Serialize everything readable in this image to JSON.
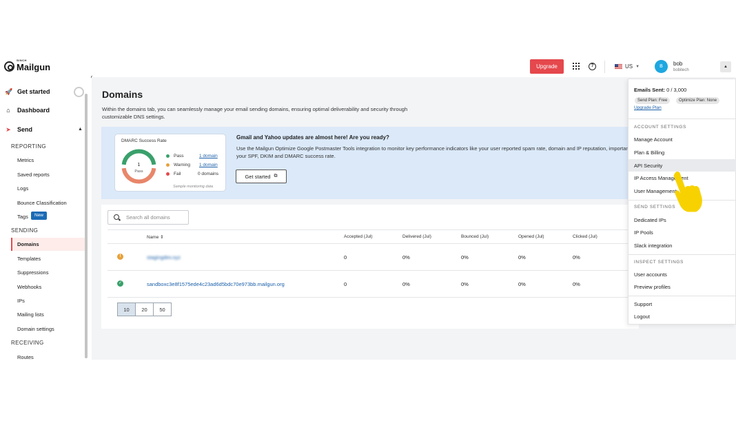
{
  "brand": {
    "small": "SINCH",
    "name": "Mailgun"
  },
  "topbar": {
    "upgrade_label": "Upgrade",
    "help_glyph": "?",
    "region": "US",
    "avatar_letter": "B",
    "user_name": "bob",
    "user_org": "bobitech",
    "toggle_glyph": "▲"
  },
  "sidebar": {
    "get_started": "Get started",
    "dashboard": "Dashboard",
    "send": "Send",
    "reporting": "REPORTING",
    "reporting_items": [
      "Metrics",
      "Saved reports",
      "Logs",
      "Bounce Classification",
      "Tags"
    ],
    "new_badge": "New",
    "sending": "SENDING",
    "sending_items": [
      "Domains",
      "Templates",
      "Suppressions",
      "Webhooks",
      "IPs",
      "Mailing lists",
      "Domain settings"
    ],
    "receiving": "RECEIVING",
    "receiving_items": [
      "Routes"
    ]
  },
  "main": {
    "title": "Domains",
    "description": "Within the domains tab, you can seamlessly manage your email sending domains, ensuring optimal deliverability and security through customizable DNS settings."
  },
  "banner": {
    "dmarc_title": "DMARC Success Rate",
    "donut_value": "1",
    "donut_label": "Pass",
    "legend": [
      {
        "label": "Pass",
        "value": "1 domain",
        "color": "#3aa06b",
        "link": true
      },
      {
        "label": "Warning",
        "value": "1 domain",
        "color": "#e8a13a",
        "link": true
      },
      {
        "label": "Fail",
        "value": "0 domains",
        "color": "#e5484d",
        "link": false
      }
    ],
    "donut_pass_fraction": 0.5,
    "sample_note": "Sample monitoring data",
    "headline": "Gmail and Yahoo updates are almost here! Are you ready?",
    "text": "Use the Mailgun Optimize Google Postmaster Tools integration to monitor key performance indicators like your user reported spam rate, domain and IP reputation, importantly your SPF, DKIM and DMARC success rate.",
    "button_label": "Get started"
  },
  "table": {
    "search_placeholder": "Search all domains",
    "columns": [
      "Name",
      "Accepted (Jul)",
      "Delivered (Jul)",
      "Bounced (Jul)",
      "Opened (Jul)",
      "Clicked (Jul)"
    ],
    "sort_glyph": "⇕",
    "rows": [
      {
        "status": "warning",
        "status_glyph": "!",
        "name": "stagingdev.xyz",
        "accepted": "0",
        "delivered": "0%",
        "bounced": "0%",
        "opened": "0%",
        "clicked": "0%"
      },
      {
        "status": "ok",
        "status_glyph": "✓",
        "name": "sandboxc3e8f1575ede4c23ad6d5bdc70e973bb.mailgun.org",
        "accepted": "0",
        "delivered": "0%",
        "bounced": "0%",
        "opened": "0%",
        "clicked": "0%"
      }
    ],
    "page_sizes": [
      "10",
      "20",
      "50"
    ],
    "selected_page_size": "10"
  },
  "dropdown": {
    "emails_sent_label": "Emails Sent:",
    "emails_sent_value": "0 / 3,000",
    "send_plan": "Send Plan: Free",
    "optimize_plan": "Optimize Plan: None",
    "upgrade_plan": "Upgrade Plan",
    "account_settings": "ACCOUNT SETTINGS",
    "account_items": [
      "Manage Account",
      "Plan & Billing",
      "API Security",
      "IP Access Management",
      "User Management"
    ],
    "send_settings": "SEND SETTINGS",
    "send_items": [
      "Dedicated IPs",
      "IP Pools",
      "Slack integration"
    ],
    "inspect_settings": "INSPECT SETTINGS",
    "inspect_items": [
      "User accounts",
      "Preview profiles"
    ],
    "bottom_items": [
      "Support",
      "Logout"
    ],
    "hovered_item": "API Security"
  },
  "colors": {
    "accent": "#e5484d",
    "link": "#1a5fa8",
    "banner_bg": "#dbe9f9",
    "cursor": "#f7d200"
  }
}
